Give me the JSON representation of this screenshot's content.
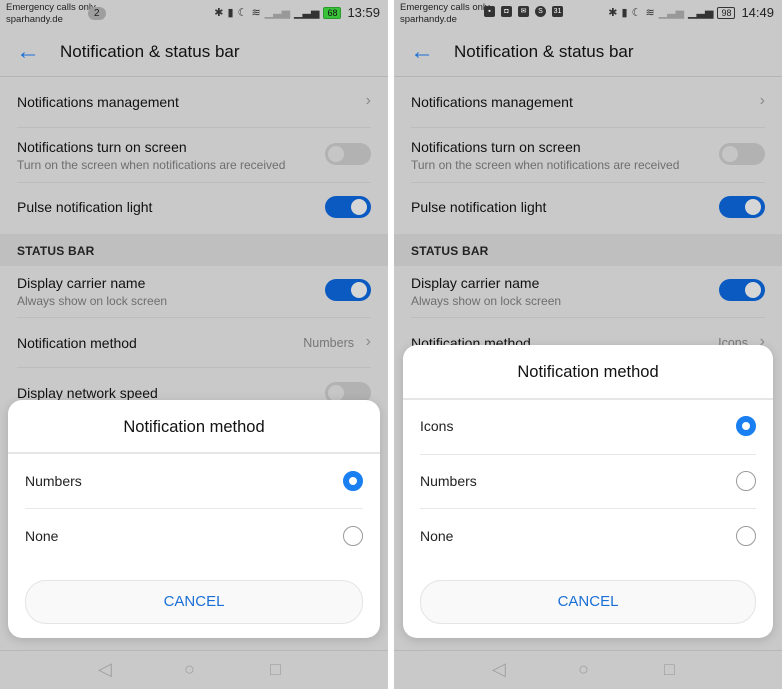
{
  "screens": [
    {
      "status_bar": {
        "carrier_line1": "Emergency calls only",
        "carrier_line2": "sparhandy.de",
        "notification_count": "2",
        "battery": "68",
        "time": "13:59",
        "icons": [
          "bluetooth-icon",
          "vibrate-icon",
          "moon-icon",
          "wifi-icon",
          "signal-icon",
          "signal-icon"
        ]
      },
      "app_bar": {
        "back_icon": "arrow-left",
        "title": "Notification & status bar"
      },
      "settings": {
        "notifications_management": "Notifications management",
        "turn_on_screen": {
          "label": "Notifications turn on screen",
          "sub": "Turn on the screen when notifications are received",
          "enabled": false
        },
        "pulse_light": {
          "label": "Pulse notification light",
          "enabled": true
        },
        "section_header": "STATUS BAR",
        "carrier_name": {
          "label": "Display carrier name",
          "sub": "Always show on lock screen",
          "enabled": true
        },
        "notification_method": {
          "label": "Notification method",
          "value": "Numbers"
        },
        "network_speed": {
          "label": "Display network speed",
          "enabled": false
        }
      },
      "dialog": {
        "title": "Notification method",
        "options": [
          {
            "label": "Numbers",
            "selected": true
          },
          {
            "label": "None",
            "selected": false
          }
        ],
        "cancel": "CANCEL"
      },
      "nav": {
        "back": "◁",
        "home": "○",
        "recents": "□"
      }
    },
    {
      "status_bar": {
        "carrier_line1": "Emergency calls only",
        "carrier_line2": "sparhandy.de",
        "app_icons": [
          "calendar-icon",
          "camera-icon",
          "mail-icon",
          "skype-icon",
          "calendar-31-icon"
        ],
        "app_icon_glyphs": [
          "▪",
          "◘",
          "✉",
          "S",
          "31"
        ],
        "battery": "98",
        "time": "14:49"
      },
      "app_bar": {
        "back_icon": "arrow-left",
        "title": "Notification & status bar"
      },
      "settings": {
        "notifications_management": "Notifications management",
        "turn_on_screen": {
          "label": "Notifications turn on screen",
          "sub": "Turn on the screen when notifications are received",
          "enabled": false
        },
        "pulse_light": {
          "label": "Pulse notification light",
          "enabled": true
        },
        "section_header": "STATUS BAR",
        "carrier_name": {
          "label": "Display carrier name",
          "sub": "Always show on lock screen",
          "enabled": true
        },
        "notification_method": {
          "label": "Notification method",
          "value": "Icons"
        }
      },
      "dialog": {
        "title": "Notification method",
        "options": [
          {
            "label": "Icons",
            "selected": true
          },
          {
            "label": "Numbers",
            "selected": false
          },
          {
            "label": "None",
            "selected": false
          }
        ],
        "cancel": "CANCEL"
      },
      "nav": {
        "back": "◁",
        "home": "○",
        "recents": "□"
      }
    }
  ],
  "colors": {
    "accent": "#1a6fd6",
    "toggle_on": "#0a5ac2",
    "radio_on": "#1a7ff0",
    "background": "#c9c9c9"
  }
}
